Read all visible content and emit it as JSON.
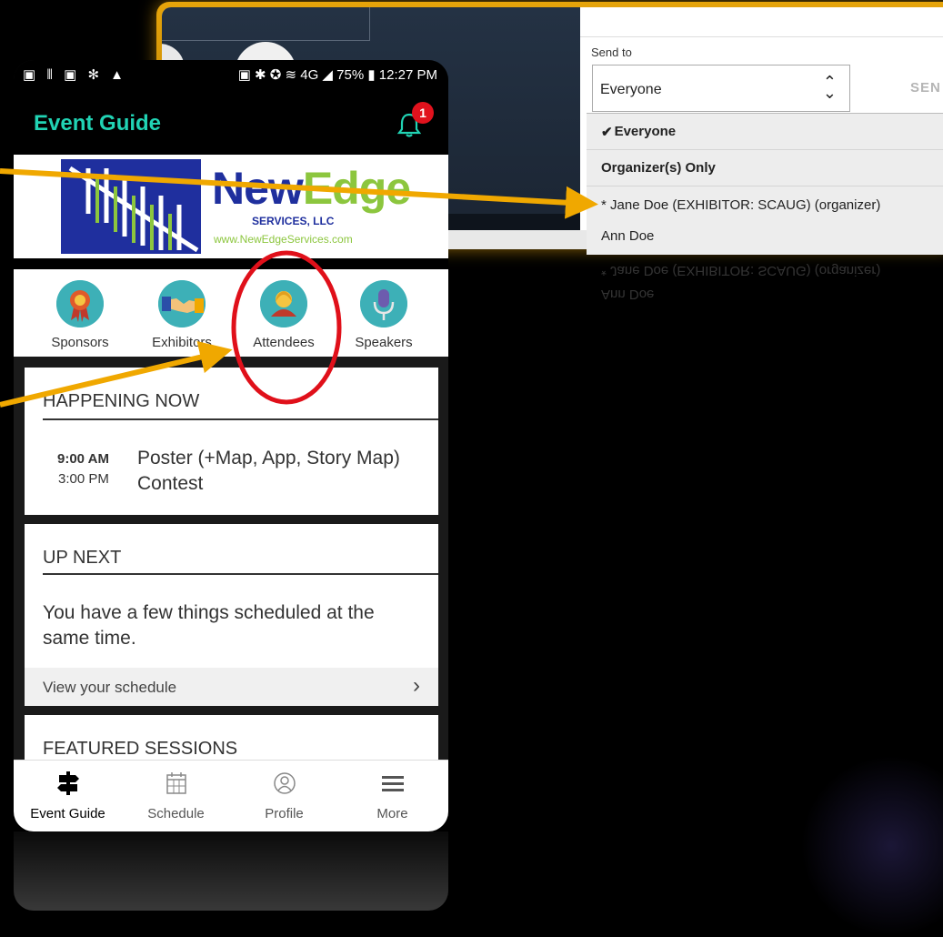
{
  "desktop": {
    "send_to_label": "Send to",
    "select_value": "Everyone",
    "send_button": "SEN",
    "dropdown": [
      {
        "label": "Everyone",
        "selected": true,
        "bold": true
      },
      {
        "label": "Organizer(s) Only",
        "bold": true
      },
      {
        "label": "* Jane Doe (EXHIBITOR: SCAUG) (organizer)"
      },
      {
        "label": "Ann Doe"
      }
    ]
  },
  "phone": {
    "status": {
      "icons_left": "▣ ⦀ ▣ ✻ ▲",
      "battery": "75%",
      "time": "12:27 PM",
      "icons_right": "▣ ✱ ✪ ≋ 4G ◢"
    },
    "title": "Event Guide",
    "notification_count": "1",
    "banner": {
      "logo_new": "New",
      "logo_edge": "Edge",
      "logo_sub": "SERVICES, LLC",
      "logo_url": "www.NewEdgeServices.com"
    },
    "categories": [
      {
        "label": "Sponsors",
        "icon": "ribbon-icon"
      },
      {
        "label": "Exhibitors",
        "icon": "handshake-icon"
      },
      {
        "label": "Attendees",
        "icon": "person-icon"
      },
      {
        "label": "Speakers",
        "icon": "microphone-icon"
      }
    ],
    "happening_now": {
      "heading": "HAPPENING NOW",
      "start": "9:00 AM",
      "end": "3:00 PM",
      "session_line1": "Poster (+Map, App, Story Map)",
      "session_line2": "Contest"
    },
    "up_next": {
      "heading": "UP NEXT",
      "message_line1": "You have a few things scheduled at the",
      "message_line2": "same time.",
      "link": "View your schedule",
      "chevron": "›"
    },
    "featured": {
      "heading": "FEATURED SESSIONS"
    },
    "nav": [
      {
        "label": "Event Guide",
        "icon": "signpost-icon",
        "active": true
      },
      {
        "label": "Schedule",
        "icon": "calendar-icon"
      },
      {
        "label": "Profile",
        "icon": "profile-icon"
      },
      {
        "label": "More",
        "icon": "menu-icon"
      }
    ]
  },
  "colors": {
    "accent_teal": "#21d3b4",
    "window_border": "#e6a40a",
    "arrow": "#f0a800",
    "highlight": "#e0101a",
    "badge": "#e1121d"
  }
}
